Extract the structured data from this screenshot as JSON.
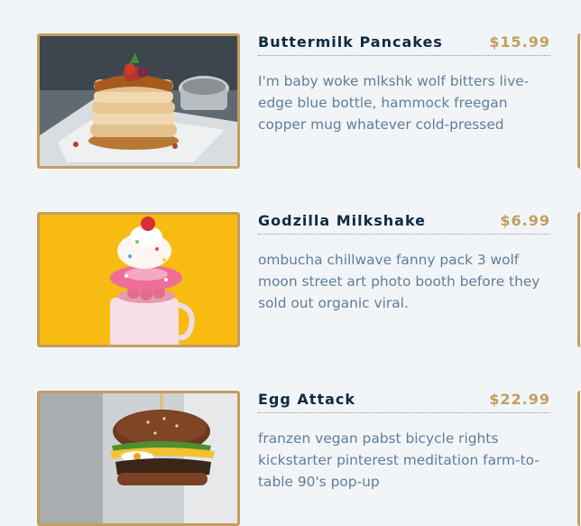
{
  "menu": {
    "items": [
      {
        "title": "Buttermilk Pancakes",
        "price": "$15.99",
        "desc": "I'm baby woke mlkshk wolf bitters live-edge blue bottle, hammock freegan copper mug whatever cold-pressed",
        "image": "pancakes-photo"
      },
      {
        "title": "Godzilla Milkshake",
        "price": "$6.99",
        "desc": "ombucha chillwave fanny pack 3 wolf moon street art photo booth before they sold out organic viral.",
        "image": "milkshake-photo"
      },
      {
        "title": "Egg Attack",
        "price": "$22.99",
        "desc": "franzen vegan pabst bicycle rights kickstarter pinterest meditation farm-to-table 90's pop-up",
        "image": "burger-photo"
      }
    ]
  },
  "colors": {
    "background": "#f1f5f8",
    "accent": "#c59d5f",
    "title": "#102a42",
    "text": "#617d98"
  }
}
